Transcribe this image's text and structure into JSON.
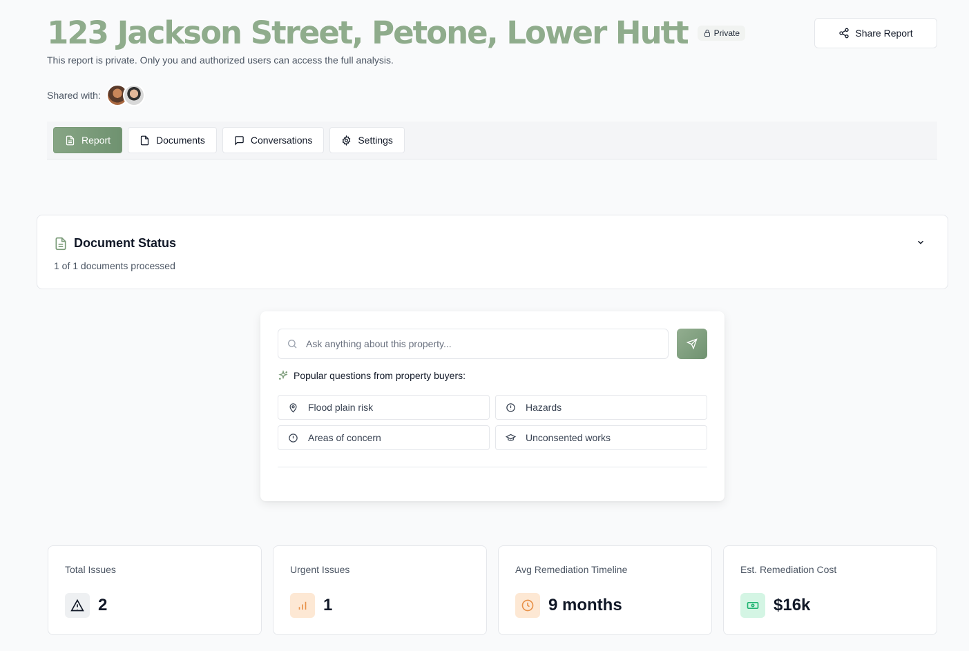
{
  "header": {
    "title": "123 Jackson Street, Petone, Lower Hutt",
    "badge": "Private",
    "subtitle": "This report is private. Only you and authorized users can access the full analysis.",
    "shared_label": "Shared with:",
    "share_button": "Share Report"
  },
  "tabs": [
    {
      "label": "Report",
      "icon": "file-text-icon",
      "active": true
    },
    {
      "label": "Documents",
      "icon": "file-icon",
      "active": false
    },
    {
      "label": "Conversations",
      "icon": "message-square-icon",
      "active": false
    },
    {
      "label": "Settings",
      "icon": "gear-icon",
      "active": false
    }
  ],
  "document_status": {
    "title": "Document Status",
    "summary": "1 of 1 documents processed"
  },
  "ask": {
    "placeholder": "Ask anything about this property...",
    "popular_label": "Popular questions from property buyers:",
    "questions": [
      {
        "label": "Flood plain risk",
        "icon": "map-pin-icon"
      },
      {
        "label": "Hazards",
        "icon": "alert-circle-icon"
      },
      {
        "label": "Areas of concern",
        "icon": "alert-circle-icon"
      },
      {
        "label": "Unconsented works",
        "icon": "graduation-cap-icon"
      }
    ]
  },
  "stats": [
    {
      "label": "Total Issues",
      "value": "2",
      "icon": "warning-triangle-icon",
      "color": "#eef0f2"
    },
    {
      "label": "Urgent Issues",
      "value": "1",
      "icon": "bar-chart-icon",
      "color": "#fde8d4"
    },
    {
      "label": "Avg Remediation Timeline",
      "value": "9 months",
      "icon": "clock-icon",
      "color": "#fde8d4"
    },
    {
      "label": "Est. Remediation Cost",
      "value": "$16k",
      "icon": "banknote-icon",
      "color": "#d4f5e4"
    }
  ],
  "colors": {
    "accent": "#7a9b78",
    "title": "#8fac8c",
    "orange": "#e8924a",
    "green": "#22b573"
  }
}
